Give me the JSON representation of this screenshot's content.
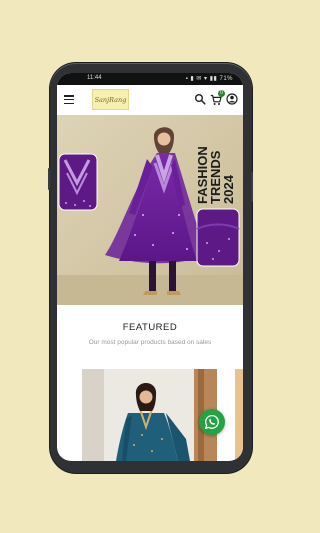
{
  "status_bar": {
    "time": "11:44",
    "indicators": "▪ ▮ ✉ ▾ ▮▮ 71%"
  },
  "header": {
    "logo_text": "SanjRang",
    "cart_count": "0",
    "icons": [
      "menu-icon",
      "search-icon",
      "cart-icon",
      "account-icon"
    ]
  },
  "banner": {
    "line1": "FASHION",
    "line2": "TRENDS",
    "line3": "2024"
  },
  "featured": {
    "title": "FEATURED",
    "subtitle": "Our most popular products based on sales"
  },
  "colors": {
    "background": "#f2e8bd",
    "accent": "#25a244",
    "banner": "#d5c9a8",
    "dress": "#6a1f9a"
  }
}
